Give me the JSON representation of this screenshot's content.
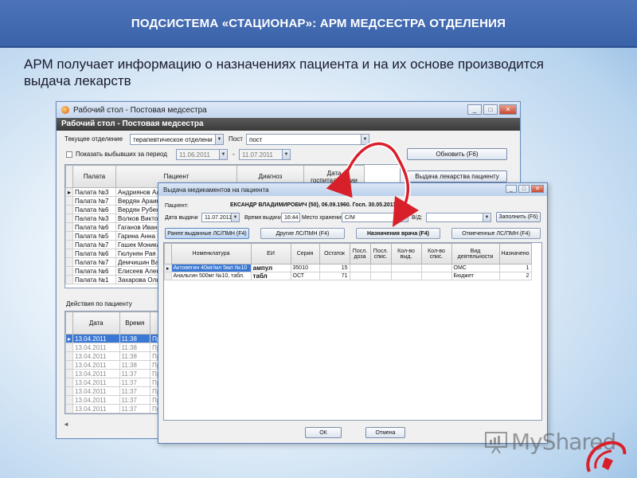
{
  "slide": {
    "title": "ПОДСИСТЕМА «СТАЦИОНАР»: АРМ МЕДСЕСТРА ОТДЕЛЕНИЯ",
    "caption": "АРМ получает информацию о назначениях пациента и на их основе производится выдача лекарств"
  },
  "back_window": {
    "title": "Рабочий стол - Постовая медсестра",
    "panel_title": "Рабочий стол - Постовая медсестра",
    "dept_label": "Текущее отделение",
    "dept_value": "терапевтическое отделени",
    "post_label": "Пост",
    "post_value": "пост",
    "show_discharged_label": "Показать выбывших за период",
    "date_from": "11.06.2011",
    "date_sep": "-",
    "date_to": "11.07.2011",
    "refresh_button": "Обновить (F6)",
    "dispense_button": "Выдача лекарства пациенту",
    "columns": [
      "Палата",
      "Пациент",
      "Диагноз",
      "Дата госпитализации"
    ],
    "rows": [
      [
        "Палата №3",
        "Андриянов Але"
      ],
      [
        "Палата №7",
        "Вердян Араик А"
      ],
      [
        "Палата №6",
        "Вердян Рубен"
      ],
      [
        "Палата №3",
        "Волков Виктор"
      ],
      [
        "Палата №6",
        "Гаганов Иван"
      ],
      [
        "Палата №5",
        "Гарина Анна И"
      ],
      [
        "Палата №7",
        "Гашек Моника"
      ],
      [
        "Палата №6",
        "Гюлунян Рая С"
      ],
      [
        "Палата №7",
        "Демчишин Вас"
      ],
      [
        "Палата №6",
        "Елисеев Алекс"
      ],
      [
        "Палата №1",
        "Захарова Ольг"
      ]
    ],
    "actions_label": "Действия по пациенту",
    "actions_columns": [
      "Дата",
      "Время"
    ],
    "actions_rows": [
      [
        "13.04.2011",
        "11:38",
        "Пр"
      ],
      [
        "13.04.2011",
        "11:38",
        "Пр"
      ],
      [
        "13.04.2011",
        "11:38",
        "Пр"
      ],
      [
        "13.04.2011",
        "11:38",
        "Пр"
      ],
      [
        "13.04.2011",
        "11:37",
        "Пр"
      ],
      [
        "13.04.2011",
        "11:37",
        "Пр"
      ],
      [
        "13.04.2011",
        "11:37",
        "Пр"
      ],
      [
        "13.04.2011",
        "11:37",
        "Пр"
      ],
      [
        "13.04.2011",
        "11:37",
        "Пр"
      ],
      [
        "13.04.2011",
        "11:37",
        "Пр"
      ]
    ]
  },
  "front_window": {
    "title": "Выдача медикаментов на пациента",
    "patient_label": "Пациент:",
    "patient_value": "ЕКСАНДР ВЛАДИМИРОВИЧ (50), 06.09.1960. Госп. 30.05.2011",
    "patient_suffix": "00",
    "date_label": "Дата выдачи",
    "date_value": "11.07.2011",
    "time_label": "Время выдачи",
    "time_value": "16:44",
    "storage_label": "Место хранения",
    "storage_value": "С/М",
    "vd_label": "В/Д:",
    "fill_button": "Заполнить (F6)",
    "tabs": [
      "Ранее выданные ЛС/ПМН (F4)",
      "Другие ЛС/ПМН (F4)",
      "Назначения врача (F4)",
      "Отмеченные ЛС/ПМН (F4)"
    ],
    "columns": [
      "Номенклатура",
      "ЕИ",
      "Серия",
      "Остаток",
      "Посл. доза",
      "Посл. спис.",
      "Кол-во выд.",
      "Кол-во спис.",
      "Вид деятельности",
      "Назначено"
    ],
    "rows": [
      [
        "Актовегин 40мг/мл 5мл №10",
        "ампул",
        "35010",
        "15",
        "",
        "",
        "",
        "",
        "ОМС",
        "1"
      ],
      [
        "Анальгин 500мг №10, табл.",
        "табл",
        "ОСТ",
        "71",
        "",
        "",
        "",
        "",
        "Бюджет",
        "2"
      ]
    ],
    "ok_button": "ОК",
    "cancel_button": "Отмена"
  },
  "logo": {
    "text": "MyShared"
  },
  "colors": {
    "header_bg": "#3f67ad",
    "selection": "#3a78d4",
    "arrow": "#d8202a"
  }
}
